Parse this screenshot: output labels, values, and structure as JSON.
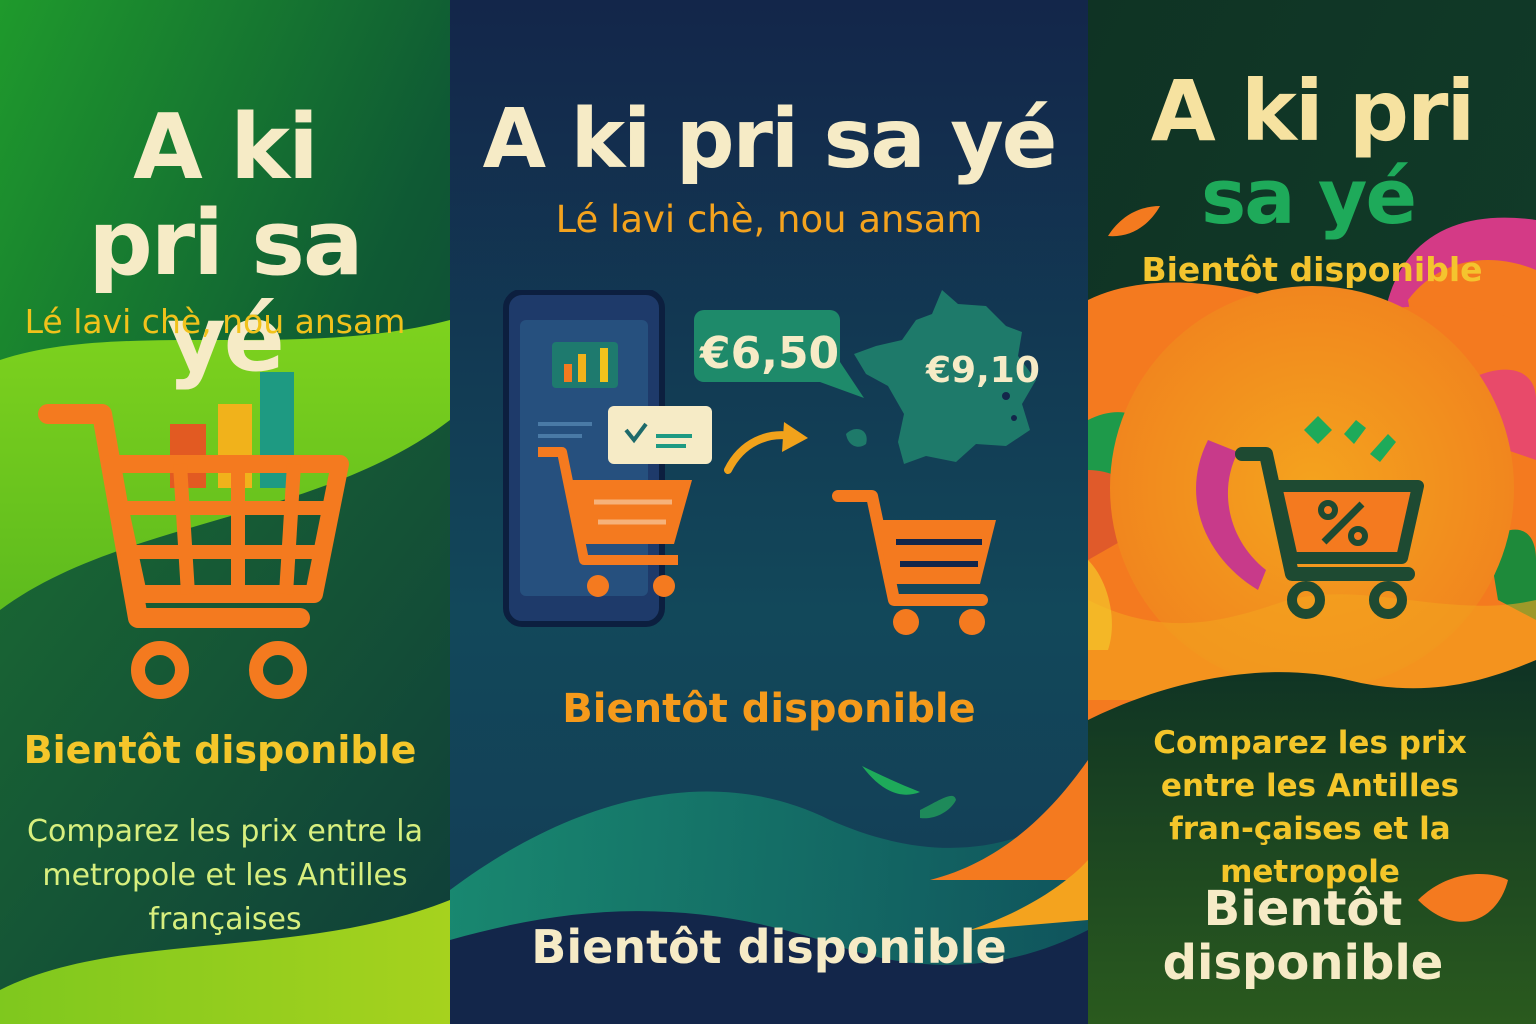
{
  "panels": [
    {
      "title": "A ki pri sa yé",
      "tagline": "Lé lavi chè, nou ansam",
      "coming_soon": "Bientôt disponible",
      "description": "Comparez les prix entre la metropole et les Antilles françaises",
      "icons": [
        "shopping-cart-icon",
        "bar-chart-icon"
      ]
    },
    {
      "title": "A ki pri sa yé",
      "tagline": "Lé lavi chè, nou ansam",
      "price_left": "€6,50",
      "price_right": "€9,10",
      "coming_soon_1": "Bientôt disponible",
      "coming_soon_2": "Bientôt disponible",
      "icons": [
        "smartphone-icon",
        "bar-chart-icon",
        "receipt-icon",
        "shopping-cart-icon",
        "arrow-icon",
        "france-map-icon"
      ]
    },
    {
      "title_line1": "A ki pri",
      "title_line2": "sa yé",
      "coming_soon_1": "Bientôt disponible",
      "description": "Comparez les prix entre les Antilles fran-çaises et la metropole",
      "coming_soon_2": "Bientôt disponible",
      "icons": [
        "discount-cart-icon",
        "percent-icon"
      ]
    }
  ],
  "colors": {
    "cream": "#f6ebc6",
    "orange": "#f47a1f",
    "yellow": "#f4c62a",
    "green": "#1eaa5a",
    "navy": "#13264a"
  }
}
